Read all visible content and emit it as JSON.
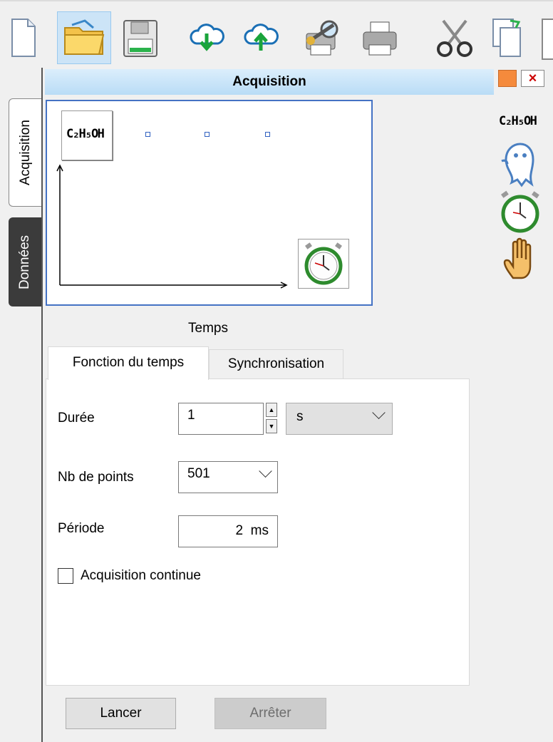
{
  "window": {
    "title": "Acquisition"
  },
  "toolbar": {
    "icons": [
      "new-file-icon",
      "open-folder-icon",
      "save-disk-icon",
      "cloud-download-icon",
      "cloud-upload-icon",
      "print-preview-icon",
      "printer-icon",
      "cut-scissors-icon",
      "copy-icon"
    ],
    "active_index": 1
  },
  "side_tabs": {
    "acquisition": "Acquisition",
    "donnees": "Données"
  },
  "canvas": {
    "sensor_formula": "C₂H₅OH",
    "time_icon": "stopwatch-icon"
  },
  "right_panel": {
    "formula": "C₂H₅OH",
    "icons": [
      "ghost-icon",
      "stopwatch-icon",
      "hand-icon"
    ]
  },
  "temps_label": "Temps",
  "tabs": {
    "fonction": "Fonction du temps",
    "sync": "Synchronisation"
  },
  "form": {
    "duree_label": "Durée",
    "duree_value": "1",
    "duree_unit": "s",
    "npoints_label": "Nb de points",
    "npoints_value": "501",
    "periode_label": "Période",
    "periode_value": "2  ms",
    "continue_label": "Acquisition continue",
    "continue_checked": false
  },
  "buttons": {
    "lancer": "Lancer",
    "arreter": "Arrêter"
  },
  "colors": {
    "title_bar": "#c7e4fa",
    "canvas_border": "#4472c4",
    "close_x": "#cc0000",
    "minimize": "#f58a3c"
  }
}
